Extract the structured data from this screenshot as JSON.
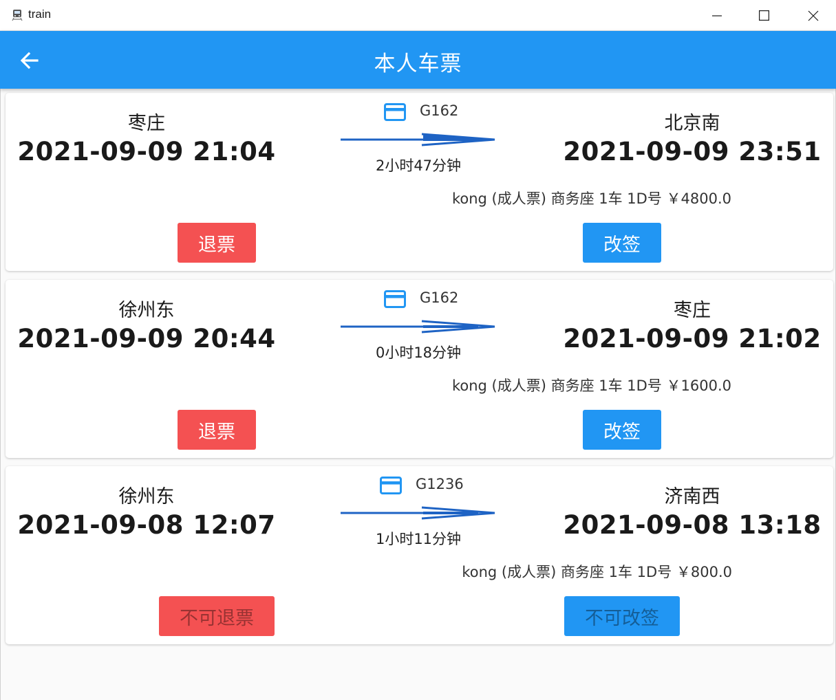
{
  "window": {
    "title": "train",
    "icon": "train-app-icon",
    "controls": [
      "minimize-icon",
      "maximize-icon",
      "close-icon"
    ]
  },
  "appbar": {
    "back_icon": "arrow-back-icon",
    "title": "本人车票"
  },
  "colors": {
    "primary": "#2196f3",
    "refund_button": "#f45152",
    "arrow": "#1e63c4",
    "background": "#fafafa"
  },
  "tickets": [
    {
      "train_no": "G162",
      "from_station": "枣庄",
      "from_time": "2021-09-09 21:04",
      "to_station": "北京南",
      "to_time": "2021-09-09 23:51",
      "duration": "2小时47分钟",
      "passenger": "kong  (成人票) 商务座 1车 1D号 ￥4800.0",
      "refund_label": "退票",
      "change_label": "改签",
      "enabled": true
    },
    {
      "train_no": "G162",
      "from_station": "徐州东",
      "from_time": "2021-09-09 20:44",
      "to_station": "枣庄",
      "to_time": "2021-09-09 21:02",
      "duration": "0小时18分钟",
      "passenger": "kong  (成人票) 商务座 1车 1D号 ￥1600.0",
      "refund_label": "退票",
      "change_label": "改签",
      "enabled": true
    },
    {
      "train_no": "G1236",
      "from_station": "徐州东",
      "from_time": "2021-09-08 12:07",
      "to_station": "济南西",
      "to_time": "2021-09-08 13:18",
      "duration": "1小时11分钟",
      "passenger": "kong  (成人票) 商务座 1车 1D号 ￥800.0",
      "refund_label": "不可退票",
      "change_label": "不可改签",
      "enabled": false
    }
  ]
}
